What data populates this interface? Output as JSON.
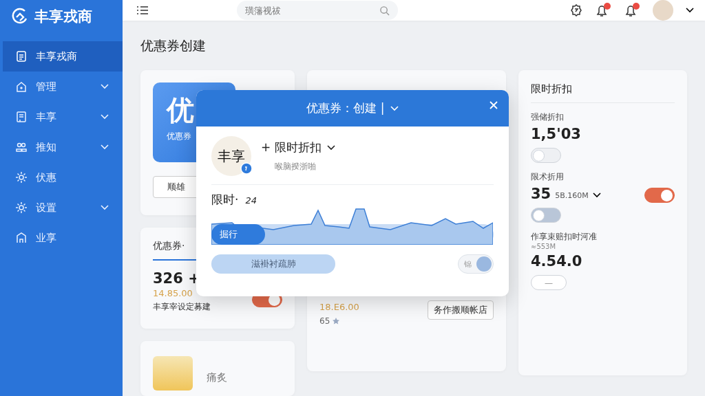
{
  "sidebar": {
    "brand": "丰享戎商",
    "items": [
      {
        "label": "丰享戎商",
        "kind": "link",
        "selected": true
      },
      {
        "label": "管理",
        "kind": "group",
        "selected": false
      },
      {
        "label": "丰享",
        "kind": "group",
        "selected": false
      },
      {
        "label": "推知",
        "kind": "group",
        "selected": false
      },
      {
        "label": "伏惠",
        "kind": "link",
        "selected": false
      },
      {
        "label": "设置",
        "kind": "group",
        "selected": false
      },
      {
        "label": "业享",
        "kind": "link",
        "selected": false
      }
    ]
  },
  "topbar": {
    "search": {
      "placeholder": "璜籓视祓"
    }
  },
  "page_title": "优惠券创建",
  "left_cards": {
    "promo": {
      "tile_big": "优",
      "tile_small": "优惠券",
      "button": "顺雄"
    },
    "stats": {
      "tab": "优惠券·",
      "value": "326 +",
      "amount": "14.85.00",
      "note": "丰享宰设定募建",
      "toggle_on": true
    },
    "bottom": {
      "label": "痛炙"
    }
  },
  "middle_card": {
    "amount": "18.E6.00",
    "note": "65",
    "button": "务作搬顺帐店"
  },
  "right_card": {
    "title": "限时折扣",
    "items": [
      {
        "kind": "toggle",
        "label": "强储折扣",
        "value": "1,5'03",
        "on": false
      },
      {
        "kind": "dual",
        "label": "限术折用",
        "value": "35",
        "value_note": "5B.160M",
        "side_on": true,
        "on": false
      },
      {
        "kind": "stepper",
        "label": "作享束赔扣时河准",
        "sub": "≈553M",
        "value": "4.54.0",
        "button": "—"
      }
    ]
  },
  "dialog": {
    "title": "优惠券：创建 |",
    "avatar": "丰享",
    "option": "+ 限时折扣",
    "option_sub": "喉脑揆浙啪",
    "slider_label": "限时·",
    "slider_value": "24",
    "slider": {
      "label": "掘行",
      "level": 0.19
    },
    "action_button": "滋褂衬疏肺",
    "toggle": {
      "label": "锦",
      "on": true
    }
  }
}
